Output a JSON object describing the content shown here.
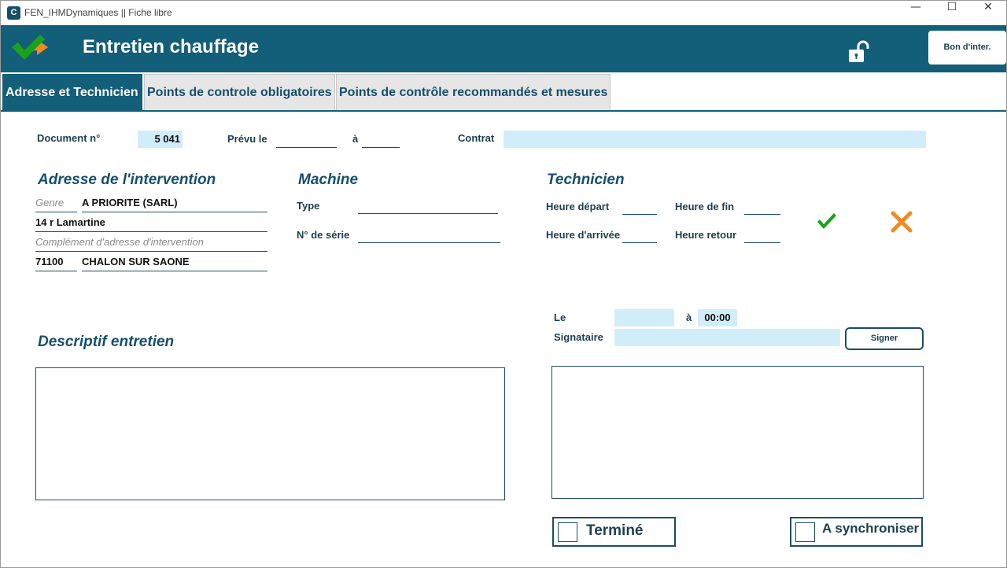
{
  "window": {
    "title": "FEN_IHMDynamiques || Fiche libre",
    "app_icon_letter": "C",
    "minimize": "—",
    "maximize": "☐",
    "close": "✕"
  },
  "header": {
    "title": "Entretien chauffage",
    "bon_button": "Bon d'inter."
  },
  "tabs": [
    {
      "label": "Adresse et Technicien",
      "active": true
    },
    {
      "label": "Points de controle obligatoires",
      "active": false
    },
    {
      "label": "Points de contrôle recommandés et mesures",
      "active": false
    }
  ],
  "top_row": {
    "document_label": "Document n°",
    "document_value": "5 041",
    "prevu_label": "Prévu le",
    "prevu_date": "",
    "a_label": "à",
    "prevu_time": "",
    "contrat_label": "Contrat",
    "contrat_value": ""
  },
  "adresse": {
    "title": "Adresse de l'intervention",
    "genre_placeholder": "Genre",
    "name": "A PRIORITE (SARL)",
    "street": "14 r Lamartine",
    "complement_placeholder": "Complément d'adresse d'intervention",
    "postcode": "71100",
    "city": "CHALON SUR SAONE"
  },
  "machine": {
    "title": "Machine",
    "type_label": "Type",
    "type_value": "",
    "serie_label": "N° de série",
    "serie_value": ""
  },
  "technicien": {
    "title": "Technicien",
    "depart_label": "Heure départ",
    "fin_label": "Heure de fin",
    "arrivee_label": "Heure d'arrivée",
    "retour_label": "Heure retour"
  },
  "signature": {
    "le_label": "Le",
    "le_value": "",
    "a_label": "à",
    "time_value": "00:00",
    "signataire_label": "Signataire",
    "signataire_value": "",
    "signer_button": "Signer"
  },
  "descriptif": {
    "title": "Descriptif entretien"
  },
  "checkboxes": {
    "termine_label": "Terminé",
    "termine_checked": false,
    "synchro_label": "A synchroniser",
    "synchro_checked": false
  },
  "colors": {
    "header_bg": "#135e78",
    "field_bg": "#d2edfa",
    "accept_green": "#1aa31a",
    "cancel_orange": "#f08a24"
  }
}
